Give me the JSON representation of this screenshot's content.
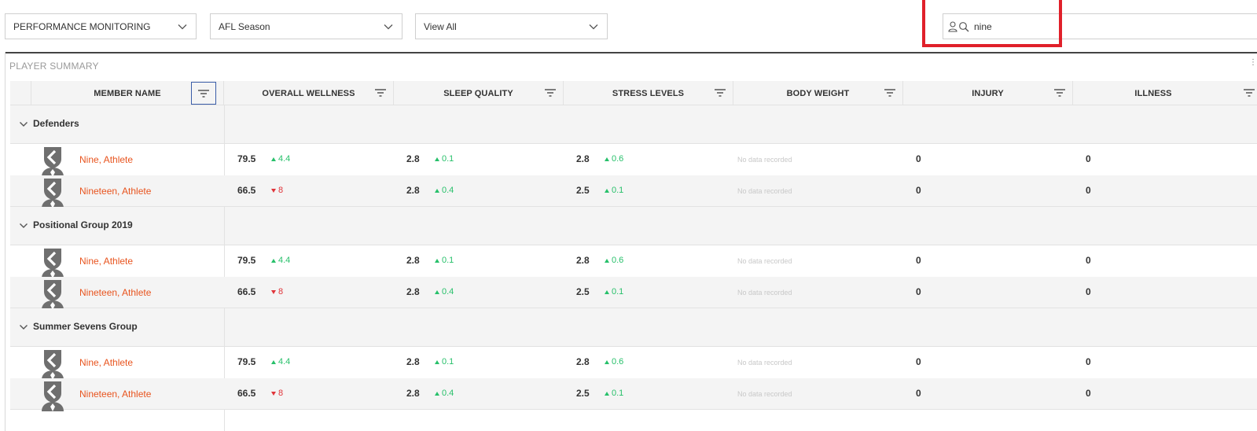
{
  "filters": {
    "module": "PERFORMANCE MONITORING",
    "season": "AFL Season",
    "view": "View All"
  },
  "search": {
    "value": "nine"
  },
  "panel": {
    "title": "PLAYER SUMMARY"
  },
  "columns": [
    "MEMBER NAME",
    "OVERALL WELLNESS",
    "SLEEP QUALITY",
    "STRESS LEVELS",
    "BODY WEIGHT",
    "INJURY",
    "ILLNESS"
  ],
  "groups": [
    {
      "name": "Defenders",
      "rows": [
        {
          "name": "Nine, Athlete",
          "wellness": "79.5",
          "wellness_delta": "4.4",
          "wellness_dir": "up",
          "sleep": "2.8",
          "sleep_delta": "0.1",
          "stress": "2.8",
          "stress_delta": "0.6",
          "body_weight": "No data recorded",
          "injury": "0",
          "illness": "0"
        },
        {
          "name": "Nineteen, Athlete",
          "wellness": "66.5",
          "wellness_delta": "8",
          "wellness_dir": "down",
          "sleep": "2.8",
          "sleep_delta": "0.4",
          "stress": "2.5",
          "stress_delta": "0.1",
          "body_weight": "No data recorded",
          "injury": "0",
          "illness": "0"
        }
      ]
    },
    {
      "name": "Positional Group 2019",
      "rows": [
        {
          "name": "Nine, Athlete",
          "wellness": "79.5",
          "wellness_delta": "4.4",
          "wellness_dir": "up",
          "sleep": "2.8",
          "sleep_delta": "0.1",
          "stress": "2.8",
          "stress_delta": "0.6",
          "body_weight": "No data recorded",
          "injury": "0",
          "illness": "0"
        },
        {
          "name": "Nineteen, Athlete",
          "wellness": "66.5",
          "wellness_delta": "8",
          "wellness_dir": "down",
          "sleep": "2.8",
          "sleep_delta": "0.4",
          "stress": "2.5",
          "stress_delta": "0.1",
          "body_weight": "No data recorded",
          "injury": "0",
          "illness": "0"
        }
      ]
    },
    {
      "name": "Summer Sevens Group",
      "rows": [
        {
          "name": "Nine, Athlete",
          "wellness": "79.5",
          "wellness_delta": "4.4",
          "wellness_dir": "up",
          "sleep": "2.8",
          "sleep_delta": "0.1",
          "stress": "2.8",
          "stress_delta": "0.6",
          "body_weight": "No data recorded",
          "injury": "0",
          "illness": "0"
        },
        {
          "name": "Nineteen, Athlete",
          "wellness": "66.5",
          "wellness_delta": "8",
          "wellness_dir": "down",
          "sleep": "2.8",
          "sleep_delta": "0.4",
          "stress": "2.5",
          "stress_delta": "0.1",
          "body_weight": "No data recorded",
          "injury": "0",
          "illness": "0"
        }
      ]
    }
  ],
  "icons": {
    "select_chevron": "chevron-down-icon",
    "search_user": "user-icon",
    "search": "search-icon",
    "column_filter": "filter-icon",
    "group_toggle": "chevron-down-icon",
    "member_avatar": "avatar-icon"
  },
  "colors": {
    "member_link": "#e8541e",
    "delta_up": "#27c06a",
    "delta_down": "#e0343a",
    "highlight": "#e0202a"
  }
}
